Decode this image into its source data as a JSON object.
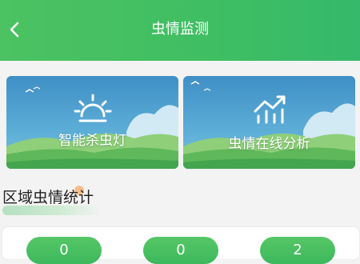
{
  "header": {
    "title": "虫情监测",
    "back_icon": "chevron-left-icon"
  },
  "cards": [
    {
      "label": "智能杀虫灯",
      "icon": "sun-lamp-icon"
    },
    {
      "label": "虫情在线分析",
      "icon": "bar-chart-trend-icon"
    }
  ],
  "section": {
    "title": "区域虫情统计"
  },
  "stats": [
    {
      "value": "0"
    },
    {
      "value": "0"
    },
    {
      "value": "2"
    }
  ],
  "colors": {
    "header_green": "#3fbe63",
    "pill_green": "#48be60",
    "card_sky": "#4a9fcf"
  }
}
